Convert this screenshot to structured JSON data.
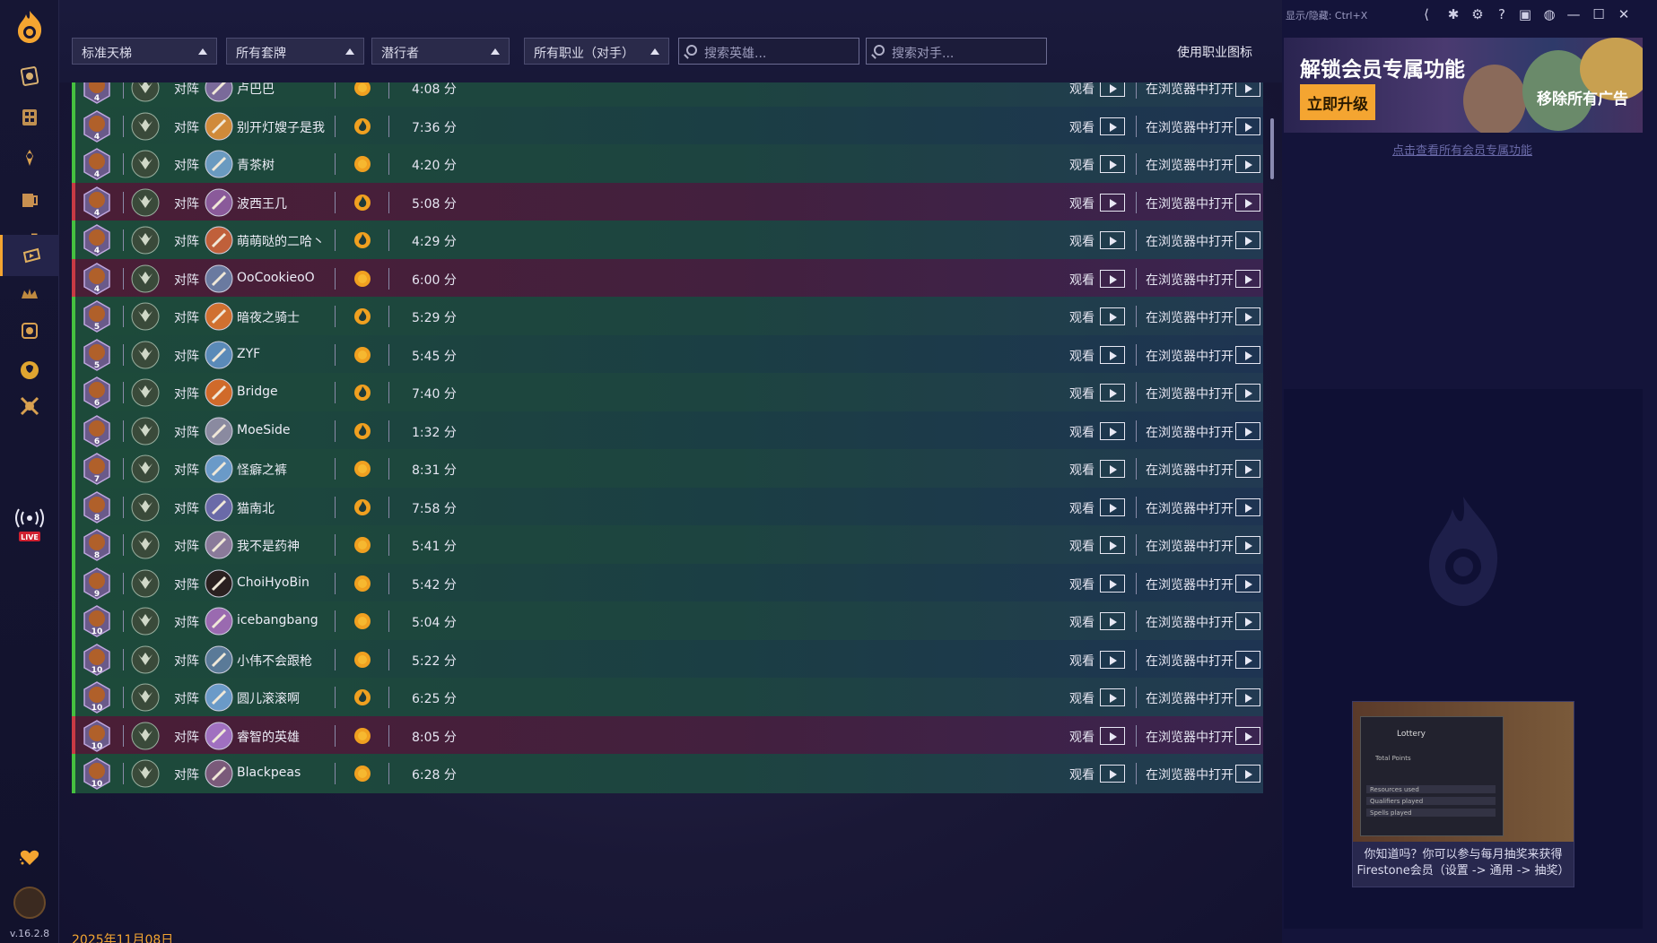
{
  "app": {
    "version": "v.16.2.8"
  },
  "filters": {
    "mode": "标准天梯",
    "deck": "所有套牌",
    "archetype": "潜行者",
    "opp_class": "所有职业（对手）",
    "search_hero_placeholder": "搜索英雄...",
    "search_opp_placeholder": "搜索对手...",
    "toggle_label": "使用职业图标"
  },
  "window": {
    "hotkey_hint": "显示/隐藏: Ctrl+X"
  },
  "promo": {
    "title": "解锁会员专属功能",
    "button": "立即升级",
    "remove_ads": "移除所有广告",
    "link": "点击查看所有会员专属功能"
  },
  "tip": {
    "line1": "你知道吗？你可以参与每月抽奖来获得",
    "line2": "Firestone会员（设置 -> 通用 -> 抽奖）",
    "mini_title": "Lottery",
    "mini_label": "Total Points",
    "mini_r1": "Resources used",
    "mini_r2": "Qualifiers played",
    "mini_r3": "Spells played"
  },
  "list": {
    "vs_label": "对阵",
    "watch_label": "观看",
    "browser_label": "在浏览器中打开",
    "date_footer": "2025年11月08日",
    "rows": [
      {
        "rank": "4",
        "opp": "卢巴巴",
        "coin": "dark",
        "duration": "4:08 分",
        "result": "win"
      },
      {
        "rank": "4",
        "opp": "别开灯嫂子是我",
        "coin": "flame",
        "duration": "7:36 分",
        "result": "win"
      },
      {
        "rank": "4",
        "opp": "青茶树",
        "coin": "dark",
        "duration": "4:20 分",
        "result": "win"
      },
      {
        "rank": "4",
        "opp": "波西王几",
        "coin": "flame",
        "duration": "5:08 分",
        "result": "loss"
      },
      {
        "rank": "4",
        "opp": "萌萌哒的二哈丶",
        "coin": "flame",
        "duration": "4:29 分",
        "result": "win"
      },
      {
        "rank": "4",
        "opp": "OoCookieoO",
        "coin": "dark",
        "duration": "6:00 分",
        "result": "loss"
      },
      {
        "rank": "5",
        "opp": "暗夜之骑士",
        "coin": "flame",
        "duration": "5:29 分",
        "result": "win"
      },
      {
        "rank": "5",
        "opp": "ZYF",
        "coin": "dark",
        "duration": "5:45 分",
        "result": "win"
      },
      {
        "rank": "6",
        "opp": "Bridge",
        "coin": "flame",
        "duration": "7:40 分",
        "result": "win"
      },
      {
        "rank": "6",
        "opp": "MoeSide",
        "coin": "flame",
        "duration": "1:32 分",
        "result": "win"
      },
      {
        "rank": "7",
        "opp": "怪癖之裤",
        "coin": "dark",
        "duration": "8:31 分",
        "result": "win"
      },
      {
        "rank": "8",
        "opp": "猫南北",
        "coin": "flame",
        "duration": "7:58 分",
        "result": "win"
      },
      {
        "rank": "8",
        "opp": "我不是药神",
        "coin": "dark",
        "duration": "5:41 分",
        "result": "win"
      },
      {
        "rank": "9",
        "opp": "ChoiHyoBin",
        "coin": "dark",
        "duration": "5:42 分",
        "result": "win"
      },
      {
        "rank": "10",
        "opp": "icebangbang",
        "coin": "dark",
        "duration": "5:04 分",
        "result": "win"
      },
      {
        "rank": "10",
        "opp": "小伟不会跟枪",
        "coin": "dark",
        "duration": "5:22 分",
        "result": "win"
      },
      {
        "rank": "10",
        "opp": "圆儿滚滚啊",
        "coin": "flame",
        "duration": "6:25 分",
        "result": "win"
      },
      {
        "rank": "10",
        "opp": "睿智的英雄",
        "coin": "dark",
        "duration": "8:05 分",
        "result": "loss"
      },
      {
        "rank": "10",
        "opp": "Blackpeas",
        "coin": "dark",
        "duration": "6:28 分",
        "result": "win"
      }
    ]
  },
  "colors": {
    "accent": "#f4a531",
    "win": "#45c040",
    "loss": "#c83a44"
  },
  "icons": [
    "firestone-logo-icon",
    "decks-icon",
    "collection-icon",
    "achievements-icon",
    "arena-icon",
    "duels-icon",
    "replays-icon",
    "battlegrounds-icon",
    "mercenaries-icon",
    "stats-icon",
    "versus-icon",
    "live-icon",
    "support-icon",
    "share-icon",
    "bug-icon",
    "settings-icon",
    "help-icon",
    "discord-icon",
    "globe-icon",
    "minimize-icon",
    "maximize-icon",
    "close-icon"
  ]
}
